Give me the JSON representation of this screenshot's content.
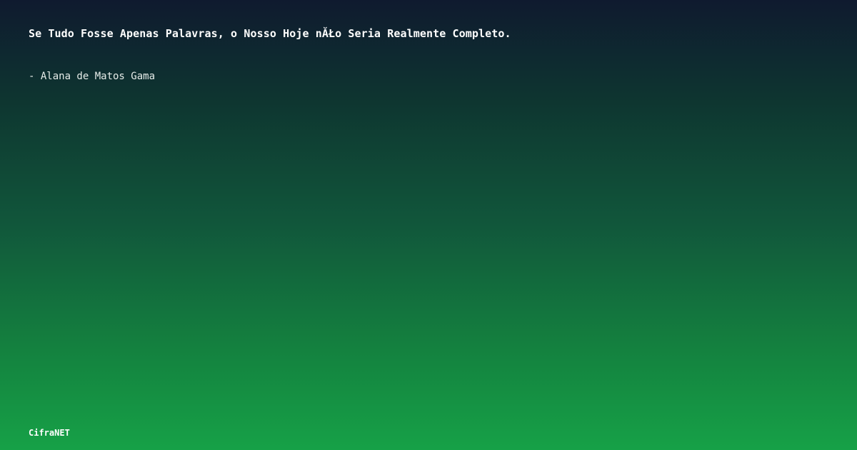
{
  "card": {
    "quote": "Se Tudo Fosse Apenas Palavras, o Nosso Hoje nĂŁo Seria Realmente Completo.",
    "author": "- Alana de Matos Gama",
    "brand": "CifraNET"
  },
  "colors": {
    "gradient_top": "#0f1a2f",
    "gradient_bottom": "#16a147",
    "text": "#ffffff"
  }
}
